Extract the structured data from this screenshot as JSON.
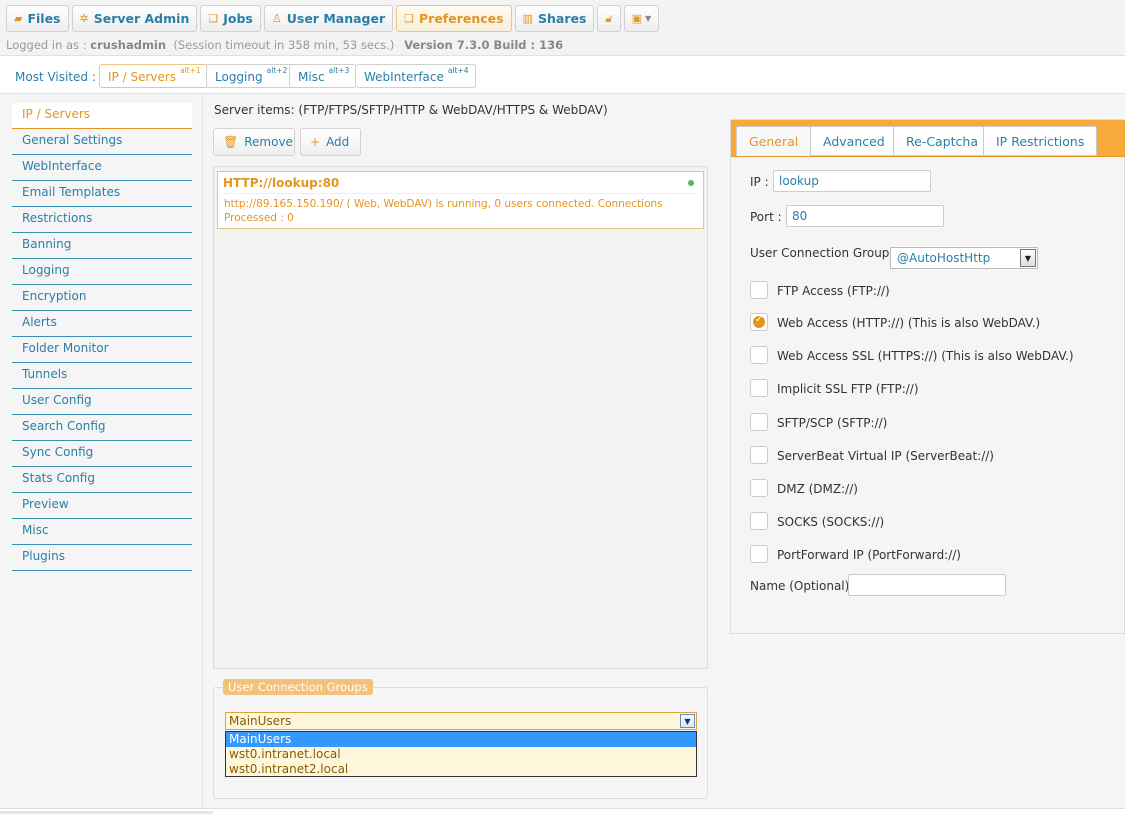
{
  "toolbar": {
    "buttons": [
      {
        "label": "Files",
        "icon": "folder-icon"
      },
      {
        "label": "Server Admin",
        "icon": "gear-icon"
      },
      {
        "label": "Jobs",
        "icon": "jobs-icon"
      },
      {
        "label": "User Manager",
        "icon": "user-icon"
      },
      {
        "label": "Preferences",
        "icon": "preferences-icon"
      },
      {
        "label": "Shares",
        "icon": "shares-icon"
      }
    ],
    "lock_icon": "lock-icon",
    "image_icon": "image-icon"
  },
  "session": {
    "prefix": "Logged in as :",
    "user": "crushadmin",
    "timeout": "(Session timeout in 358 min, 53 secs.)",
    "version": "Version 7.3.0 Build : 136"
  },
  "most_visited": {
    "label": "Most Visited :",
    "tabs": [
      {
        "label": "IP / Servers",
        "shortcut": "alt+1"
      },
      {
        "label": "Logging",
        "shortcut": "alt+2"
      },
      {
        "label": "Misc",
        "shortcut": "alt+3"
      },
      {
        "label": "WebInterface",
        "shortcut": "alt+4"
      }
    ]
  },
  "sidebar": {
    "items": [
      "IP / Servers",
      "General Settings",
      "WebInterface",
      "Email Templates",
      "Restrictions",
      "Banning",
      "Logging",
      "Encryption",
      "Alerts",
      "Folder Monitor",
      "Tunnels",
      "User Config",
      "Search Config",
      "Sync Config",
      "Stats Config",
      "Preview",
      "Misc",
      "Plugins"
    ]
  },
  "servers": {
    "title": "Server items: (FTP/FTPS/SFTP/HTTP & WebDAV/HTTPS & WebDAV)",
    "remove_label": "Remove",
    "add_label": "Add",
    "items": [
      {
        "name": "HTTP://lookup:80",
        "status": "http://89.165.150.190/ ( Web, WebDAV) is running, 0 users connected. Connections Processed : 0"
      }
    ]
  },
  "user_connection_groups": {
    "legend": "User Connection Groups",
    "selected": "MainUsers",
    "options": [
      "MainUsers",
      "wst0.intranet.local",
      "wst0.intranet2.local"
    ]
  },
  "right_panel": {
    "tabs": [
      "General",
      "Advanced",
      "Re-Captcha",
      "IP Restrictions"
    ],
    "ip_label": "IP :",
    "ip_value": "lookup",
    "port_label": "Port :",
    "port_value": "80",
    "ucg_label": "User Connection Groups",
    "ucg_value": "@AutoHostHttp",
    "checkboxes": [
      {
        "label": "FTP Access (FTP://)",
        "checked": false
      },
      {
        "label": "Web Access (HTTP://) (This is also WebDAV.)",
        "checked": true
      },
      {
        "label": "Web Access SSL (HTTPS://) (This is also WebDAV.)",
        "checked": false
      },
      {
        "label": "Implicit SSL FTP (FTP://)",
        "checked": false
      },
      {
        "label": "SFTP/SCP (SFTP://)",
        "checked": false
      },
      {
        "label": "ServerBeat Virtual IP (ServerBeat://)",
        "checked": false
      },
      {
        "label": "DMZ (DMZ://)",
        "checked": false
      },
      {
        "label": "SOCKS (SOCKS://)",
        "checked": false
      },
      {
        "label": "PortForward IP (PortForward://)",
        "checked": false
      }
    ],
    "name_label": "Name (Optional):",
    "name_value": ""
  },
  "colors": {
    "accent": "#e4951d",
    "link": "#2a7fa8",
    "tab_bar": "#f7a93c"
  }
}
